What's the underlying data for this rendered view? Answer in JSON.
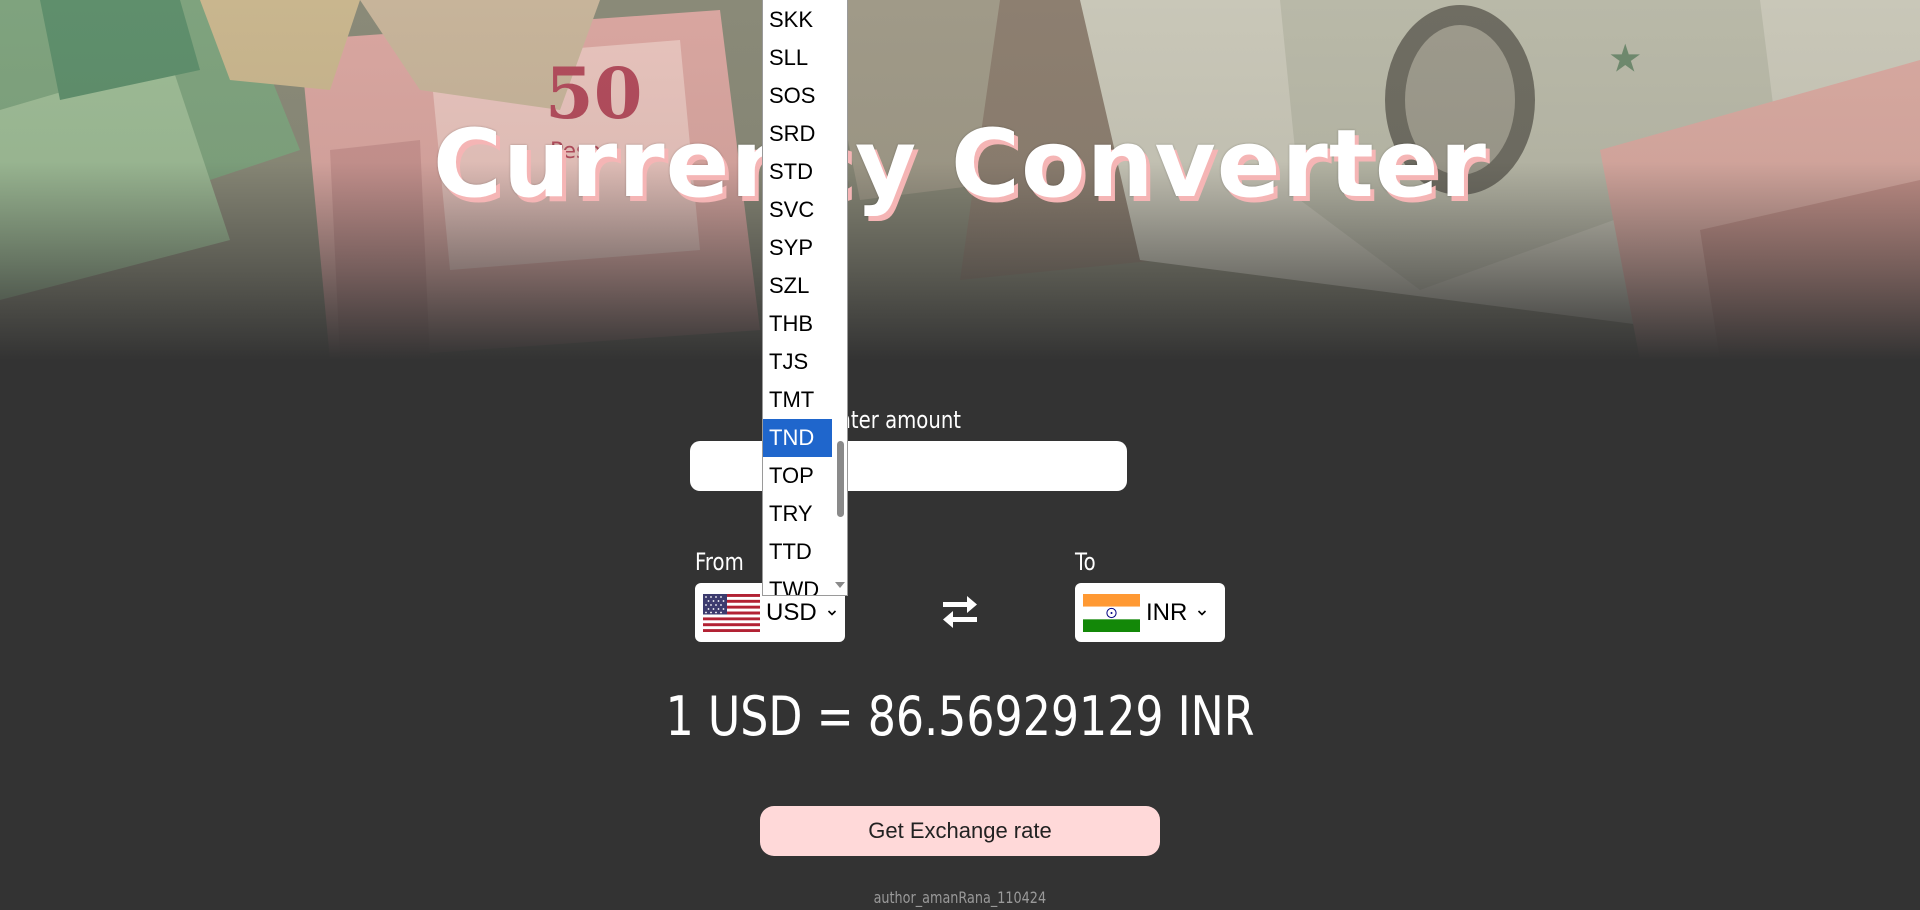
{
  "header": {
    "title": "Currency Converter"
  },
  "form": {
    "amount_label": "Enter amount",
    "amount_value": "",
    "from_label": "From",
    "to_label": "To",
    "from_currency": "USD",
    "to_currency": "INR",
    "from_flag_icon": "us-flag-icon",
    "to_flag_icon": "india-flag-icon",
    "swap_icon": "swap-arrows-icon"
  },
  "result": {
    "text": "1 USD = 86.56929129 INR"
  },
  "actions": {
    "get_rate_label": "Get Exchange rate"
  },
  "footer": {
    "author": "author_amanRana_110424"
  },
  "dropdown": {
    "open_for": "from-currency",
    "highlighted": "TND",
    "visible_options": [
      "SKK",
      "SLL",
      "SOS",
      "SRD",
      "STD",
      "SVC",
      "SYP",
      "SZL",
      "THB",
      "TJS",
      "TMT",
      "TND",
      "TOP",
      "TRY",
      "TTD",
      "TWD"
    ]
  },
  "colors": {
    "background": "#333333",
    "accent_button": "#ffd9d9",
    "title_shadow": "#f5b5b5",
    "selection": "#1f66cc"
  }
}
